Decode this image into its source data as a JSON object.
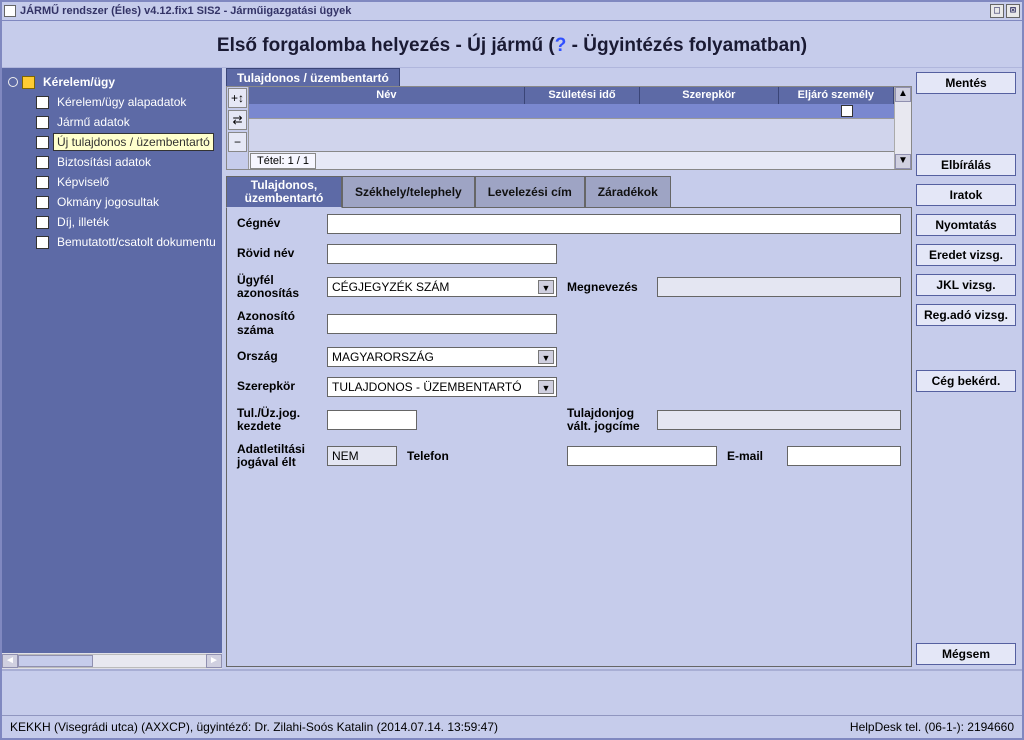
{
  "window": {
    "title": "JÁRMŰ rendszer (Éles) v4.12.fix1 SIS2 - Járműigazgatási ügyek"
  },
  "page_title": {
    "prefix": "Első forgalomba helyezés - Új jármű (",
    "q": "?",
    "suffix": " - Ügyintézés folyamatban)"
  },
  "tree": {
    "root": "Kérelem/ügy",
    "items": [
      "Kérelem/ügy alapadatok",
      "Jármű adatok",
      "Új tulajdonos / üzembentartó",
      "Biztosítási adatok",
      "Képviselő",
      "Okmány jogosultak",
      "Díj, illeték",
      "Bemutatott/csatolt dokumentu"
    ],
    "selected_index": 2
  },
  "section_tab": "Tulajdonos / üzembentartó",
  "grid": {
    "columns": [
      "Név",
      "Születési idő",
      "Szerepkör",
      "Eljáró személy"
    ],
    "counter": "Tétel: 1 / 1"
  },
  "tabs": [
    "Tulajdonos, üzembentartó",
    "Székhely/telephely",
    "Levelezési cím",
    "Záradékok"
  ],
  "active_tab": 0,
  "form": {
    "labels": {
      "cegnev": "Cégnév",
      "rovid_nev": "Rövid név",
      "ugyfel_azon": "Ügyfél azonosítás",
      "megnevezes": "Megnevezés",
      "azon_szama": "Azonosító száma",
      "orszag": "Ország",
      "szerepkor": "Szerepkör",
      "tul_uz_kezd": "Tul./Üz.jog. kezdete",
      "tuljog_valt": "Tulajdonjog vált. jogcíme",
      "adatlet": "Adatletiltási jogával élt",
      "telefon": "Telefon",
      "email": "E-mail"
    },
    "values": {
      "cegnev": "",
      "rovid_nev": "",
      "ugyfel_azon": "CÉGJEGYZÉK SZÁM",
      "megnevezes": "",
      "azon_szama": "",
      "orszag": "MAGYARORSZÁG",
      "szerepkor": "TULAJDONOS - ÜZEMBENTARTÓ",
      "tul_uz_kezd": "",
      "tuljog_valt": "",
      "adatlet": "NEM",
      "telefon": "",
      "email": ""
    }
  },
  "buttons": {
    "mentes": "Mentés",
    "elbiralas": "Elbírálás",
    "iratok": "Iratok",
    "nyomtatas": "Nyomtatás",
    "eredet": "Eredet vizsg.",
    "jkl": "JKL vizsg.",
    "regado": "Reg.adó vizsg.",
    "cegbekerd": "Cég bekérd.",
    "megsem": "Mégsem"
  },
  "status": {
    "left": "KEKKH (Visegrádi utca) (AXXCP), ügyintéző: Dr. Zilahi-Soós Katalin (2014.07.14. 13:59:47)",
    "right": "HelpDesk tel. (06-1-): 2194660"
  }
}
